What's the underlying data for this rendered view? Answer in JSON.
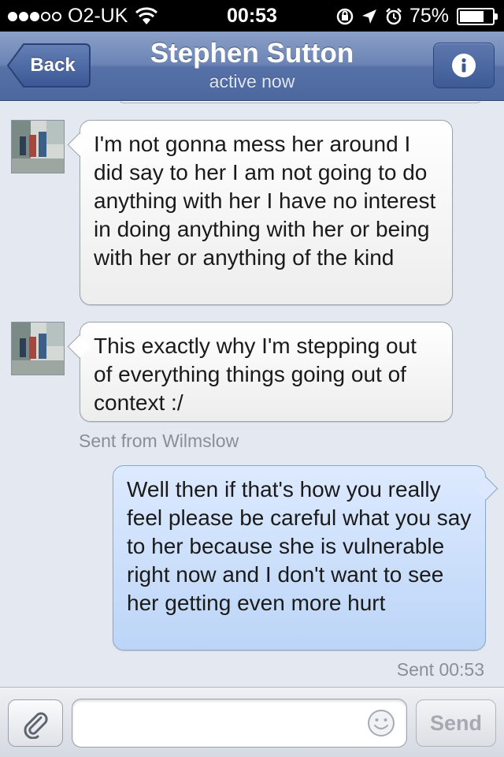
{
  "status_bar": {
    "carrier": "O2-UK",
    "signal_bars_filled": 3,
    "signal_bars_total": 5,
    "time": "00:53",
    "battery_percent": "75%",
    "battery_level": 0.75,
    "icons": [
      "wifi-icon",
      "rotation-lock-icon",
      "location-arrow-icon",
      "alarm-icon",
      "battery-icon"
    ]
  },
  "nav": {
    "back_label": "Back",
    "title": "Stephen Sutton",
    "subtitle": "active now",
    "info_icon": "info-icon"
  },
  "messages": [
    {
      "direction": "incoming",
      "text": "I'm not gonna mess her around I did say to her I am not going to do anything with her I have no interest in doing anything with her or being with her or anything of the kind"
    },
    {
      "direction": "incoming",
      "text": "This exactly why I'm stepping out of everything things going out of context :/",
      "meta": "Sent from Wilmslow"
    },
    {
      "direction": "outgoing",
      "text": "Well then if that's how you really feel please be careful what you say to her because she is vulnerable right now and I don't want to see her getting even more hurt",
      "meta": "Sent 00:53"
    }
  ],
  "composer": {
    "input_value": "",
    "send_label": "Send",
    "attach_icon": "paperclip-icon",
    "emoji_icon": "smiley-icon"
  },
  "colors": {
    "nav_bar": "#6b84b5",
    "background": "#e4e8f1",
    "outgoing_bubble": "#c9ddfa",
    "incoming_bubble": "#f6f6f6"
  }
}
